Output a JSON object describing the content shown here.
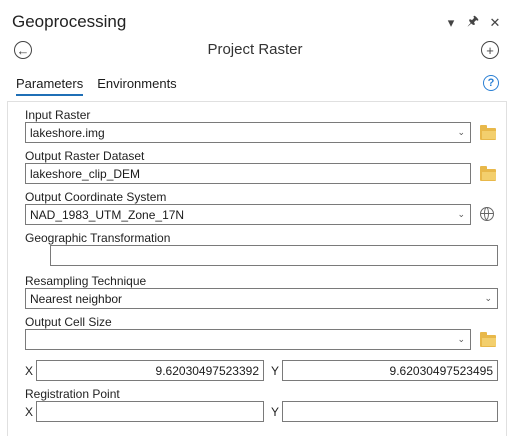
{
  "pane": {
    "title": "Geoprocessing"
  },
  "titlebar_icons": [
    "chevron-down-icon",
    "pin-icon",
    "close-icon"
  ],
  "tool": {
    "title": "Project Raster"
  },
  "tabs": [
    {
      "label": "Parameters",
      "active": true
    },
    {
      "label": "Environments",
      "active": false
    }
  ],
  "help_glyph": "?",
  "params": {
    "input_raster": {
      "label": "Input Raster",
      "value": "lakeshore.img"
    },
    "output_raster": {
      "label": "Output Raster Dataset",
      "value": "lakeshore_clip_DEM"
    },
    "output_cs": {
      "label": "Output Coordinate System",
      "value": "NAD_1983_UTM_Zone_17N"
    },
    "geo_transform": {
      "label": "Geographic Transformation",
      "value": ""
    },
    "resampling": {
      "label": "Resampling Technique",
      "value": "Nearest neighbor"
    },
    "cell_size": {
      "label": "Output Cell Size",
      "value": "",
      "x_label": "X",
      "x_value": "9.62030497523392",
      "y_label": "Y",
      "y_value": "9.62030497523495"
    },
    "registration": {
      "label": "Registration Point",
      "x_label": "X",
      "x_value": "",
      "y_label": "Y",
      "y_value": ""
    }
  },
  "colors": {
    "accent": "#1f6fb6",
    "help": "#2a7fd4",
    "folder": "#e8b84a"
  }
}
